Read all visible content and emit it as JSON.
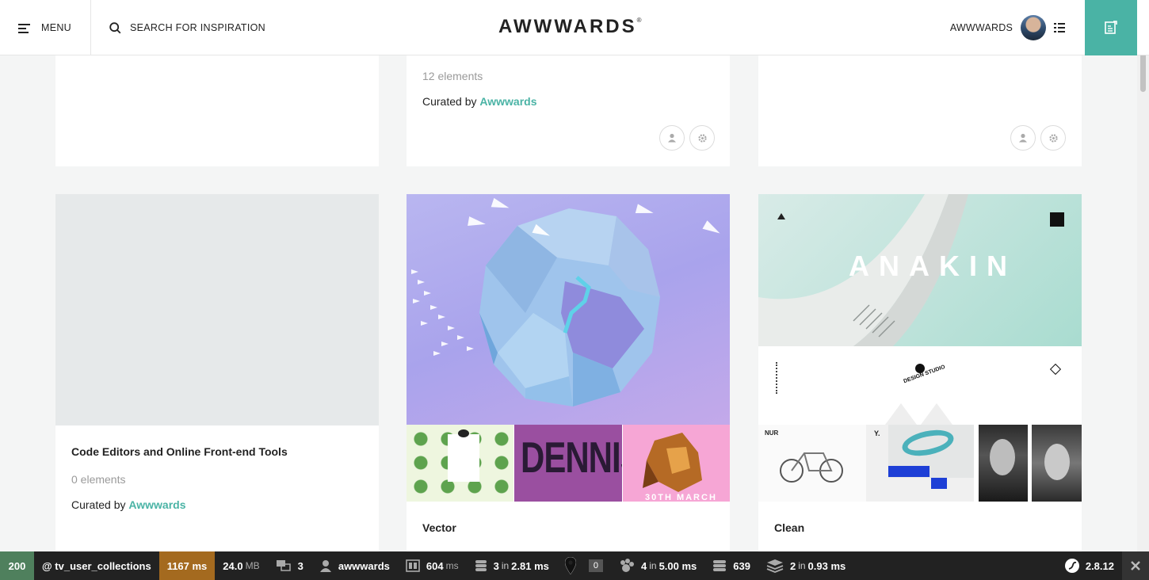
{
  "header": {
    "menu_label": "MENU",
    "search_label": "SEARCH FOR INSPIRATION",
    "logo_text": "AWWWARDS",
    "logo_mark": "®",
    "username": "AWWWARDS",
    "accent_color": "#4ab3a5"
  },
  "top_row": {
    "middle_card": {
      "count": "12 elements",
      "curated_prefix": "Curated by",
      "curator": "Awwwards"
    }
  },
  "collections": [
    {
      "title": "Code Editors and Online Front-end Tools",
      "count": "0 elements",
      "curated_prefix": "Curated by",
      "curator": "Awwwards"
    },
    {
      "title": "Vector",
      "thumb_text_dennis": "DENNIS",
      "thumb_text_march": "30TH MARCH"
    },
    {
      "title": "Clean",
      "thumb_text_anakin": "ANAKIN",
      "thumb_text_studio": "DESIGN STUDIO",
      "thumb_text_nur": "NUR",
      "thumb_text_y": "Y."
    }
  ],
  "toolbar": {
    "status": "200",
    "route": "@ tv_user_collections",
    "time": "1167 ms",
    "memory_value": "24.0",
    "memory_unit": "MB",
    "translations": "3",
    "user": "awwwards",
    "render_value": "604",
    "render_unit": "ms",
    "db_count": "3",
    "db_in": "in",
    "db_time": "2.81 ms",
    "events_badge": "0",
    "logs_count": "4",
    "logs_in": "in",
    "logs_time": "5.00 ms",
    "cache_count": "639",
    "twig_count": "2",
    "twig_in": "in",
    "twig_time": "0.93 ms",
    "version": "2.8.12"
  }
}
